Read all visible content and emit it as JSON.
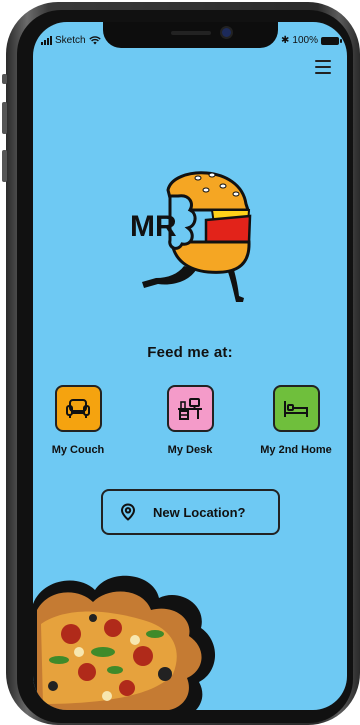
{
  "status": {
    "carrier": "Sketch",
    "battery_text": "100%",
    "bluetooth": "✱"
  },
  "header": {
    "menu_icon": "hamburger-menu-icon"
  },
  "logo": {
    "text": "MR",
    "icon": "burger-running-logo"
  },
  "feed": {
    "heading": "Feed me at:"
  },
  "options": [
    {
      "label": "My Couch",
      "icon": "couch-icon",
      "color": "#f5a30f"
    },
    {
      "label": "My Desk",
      "icon": "desk-icon",
      "color": "#f49bc9"
    },
    {
      "label": "My 2nd Home",
      "icon": "bed-icon",
      "color": "#6fbf3c"
    }
  ],
  "new_location": {
    "label": "New Location?",
    "icon": "location-pin-icon"
  },
  "colors": {
    "screen_bg": "#6ec9f3",
    "burger_bun": "#f5a623",
    "burger_red": "#e2231a",
    "cheese": "#ffd21a"
  }
}
